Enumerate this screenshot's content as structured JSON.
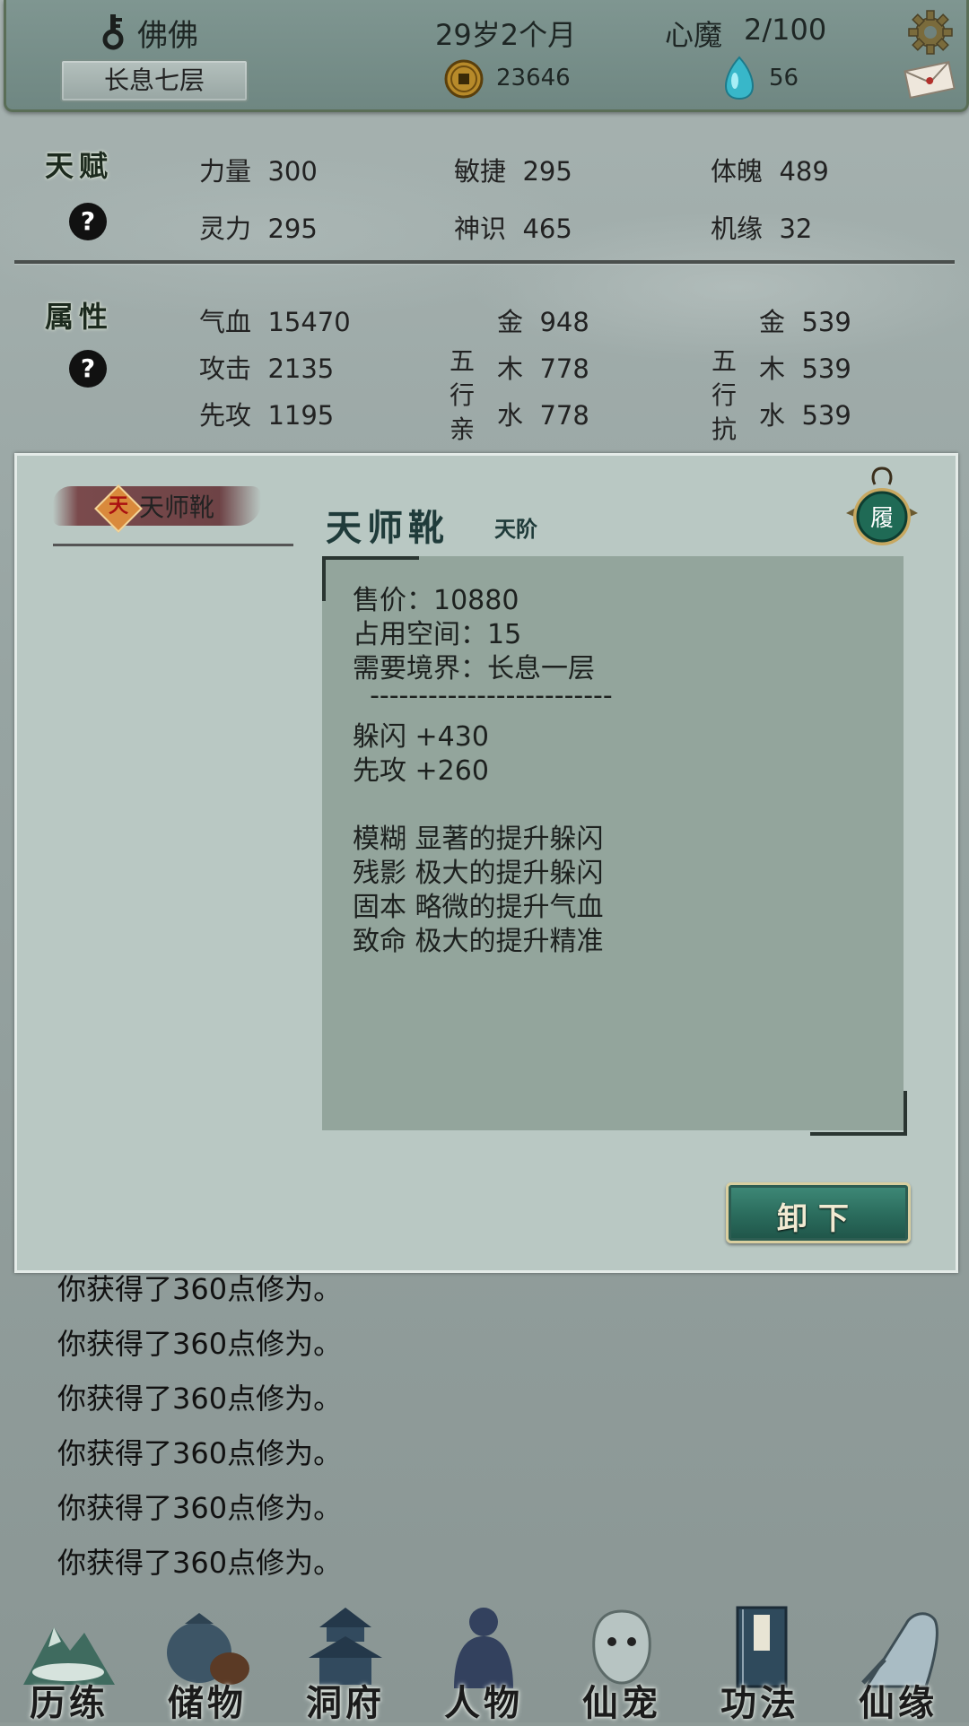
{
  "header": {
    "player_name": "佛佛",
    "realm": "长息七层",
    "age": "29岁2个月",
    "coins": "23646",
    "demon_label": "心魔",
    "demon_value": "2/100",
    "gems": "56",
    "icons": [
      "key-icon",
      "coin-icon",
      "gem-icon",
      "gear-icon",
      "mail-icon"
    ]
  },
  "talent": {
    "title": "天赋",
    "help": "?",
    "stats": [
      {
        "label": "力量",
        "value": "300"
      },
      {
        "label": "敏捷",
        "value": "295"
      },
      {
        "label": "体魄",
        "value": "489"
      },
      {
        "label": "灵力",
        "value": "295"
      },
      {
        "label": "神识",
        "value": "465"
      },
      {
        "label": "机缘",
        "value": "32"
      }
    ]
  },
  "attributes": {
    "title": "属性",
    "help": "?",
    "base": [
      {
        "label": "气血",
        "value": "15470"
      },
      {
        "label": "攻击",
        "value": "2135"
      },
      {
        "label": "先攻",
        "value": "1195"
      }
    ],
    "affinity_title": [
      "五",
      "行",
      "亲"
    ],
    "affinity": [
      {
        "label": "金",
        "value": "948"
      },
      {
        "label": "木",
        "value": "778"
      },
      {
        "label": "水",
        "value": "778"
      }
    ],
    "resist_title": [
      "五",
      "行",
      "抗"
    ],
    "resist": [
      {
        "label": "金",
        "value": "539"
      },
      {
        "label": "木",
        "value": "539"
      },
      {
        "label": "水",
        "value": "539"
      }
    ]
  },
  "modal": {
    "tab_badge": "天",
    "tab_label": "天师靴",
    "item_name": "天师靴",
    "item_grade": "天阶",
    "slot_label": "履",
    "lines": [
      "售价：10880",
      "占用空间：15",
      "需要境界：长息一层",
      "  -------------------------",
      "躲闪 +430",
      "先攻 +260",
      "",
      "模糊 显著的提升躲闪",
      "残影 极大的提升躲闪",
      "固本 略微的提升气血",
      "致命 极大的提升精准"
    ],
    "unequip_label": "卸下"
  },
  "log": [
    "你获得了360点修为。",
    "你获得了360点修为。",
    "你获得了360点修为。",
    "你获得了360点修为。",
    "你获得了360点修为。",
    "你获得了360点修为。"
  ],
  "nav": [
    {
      "label": "历练",
      "icon": "mountain-icon"
    },
    {
      "label": "储物",
      "icon": "bag-icon"
    },
    {
      "label": "洞府",
      "icon": "pagoda-icon"
    },
    {
      "label": "人物",
      "icon": "character-icon"
    },
    {
      "label": "仙宠",
      "icon": "spirit-pet-icon"
    },
    {
      "label": "功法",
      "icon": "scroll-book-icon"
    },
    {
      "label": "仙缘",
      "icon": "crane-icon"
    }
  ]
}
